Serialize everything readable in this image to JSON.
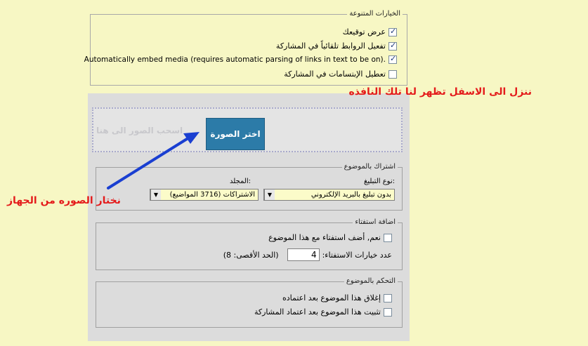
{
  "misc_options": {
    "legend": "الخيارات المتنوعة",
    "items": [
      {
        "label": "عرض توقيعك",
        "checked": true
      },
      {
        "label": "تفعيل الروابط تلقائياً في المشاركة",
        "checked": true
      },
      {
        "label": "Automatically embed media (requires automatic parsing of links in text to be on).",
        "checked": true
      },
      {
        "label": "تعطيل الإبتسامات في المشاركة",
        "checked": false
      }
    ]
  },
  "upload": {
    "drop_hint": "اسحب الصور الى هنا",
    "choose_button": "اختر الصورة"
  },
  "subscription": {
    "legend": "اشتراك بالموضوع",
    "notify_label": "نوع التبليغ:",
    "notify_value": "بدون تبليغ بالبريد الإلكتروني",
    "folder_label": "المجلد:",
    "folder_value": "الاشتراكات (3716 المواضيع)"
  },
  "poll": {
    "legend": "اضافة استفتاء",
    "add_poll_label": "نعم, أضف استفتاء مع هذا الموضوع",
    "options_label": "عدد خيارات الاستفتاء:",
    "options_value": "4",
    "max_note": "(الحد الأقصى: 8)"
  },
  "moderation": {
    "legend": "التحكم بالموضوع",
    "items": [
      {
        "label": "إغلاق هذا الموضوع بعد اعتماده",
        "checked": false
      },
      {
        "label": "تثبيت هذا الموضوع بعد اعتماد المشاركة",
        "checked": false
      }
    ]
  },
  "annotations": {
    "scroll_note": "ننزل الى الاسفل تظهر لنا تلك النافذه",
    "choose_note": "نختار الصوره من الجهاز",
    "note_color": "#e41b1b",
    "arrow_color": "#1a3fd1"
  }
}
